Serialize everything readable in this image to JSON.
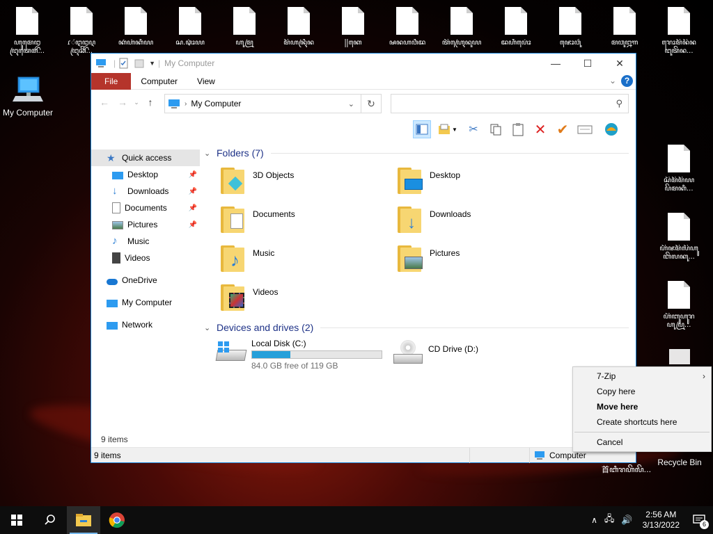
{
  "desktop": {
    "icons_top": [
      {
        "label": "ꦲꦸꦩꦺꦈ\nꦔꦿꦠꦺꦩ..."
      },
      {
        "label": "ɾꦁꦅꦈꦉ\nꦔꦿꦕꦼ..."
      },
      {
        "label": "ꦏꦁꦲꦁꦏꦶꦪ\n"
      },
      {
        "label": "ꦱ.ꦡꦴꦁꦪ\n"
      },
      {
        "label": "ꦲꦸꦩꦿꦸ\n"
      },
      {
        "label": "ꦩꦼꦲꦤꦿꦶꦤ\n"
      },
      {
        "label": "꧍꧍ꦏꦺ\n"
      },
      {
        "label": "ꦰꦤꦲꦮꦶꦢ\n"
      },
      {
        "label": "ꦠꦼꦲꦿꦺꦤꦸꦪ\n"
      },
      {
        "label": "ꦢꦲꦶꦥꦺꦴꦁ\n"
      },
      {
        "label": "ꦗꦺꦴꦮꦸꦂ\n"
      },
      {
        "label": "ꦩꦮꦸꦊꦒ\n"
      },
      {
        "label": "ꦫꦺꦴꦩꦼꦤꦼꦤ\nꦔꦸꦠꦼꦤ..."
      }
    ],
    "icons_right": [
      {
        "label": "ꦱꦼꦩꦼꦩꦼꦪ\nꦥꦼꦩꦏꦶ..."
      },
      {
        "label": "ꦲꦼꦗꦩꦼꦭꦼꦲꦸ\nꦧꦼꦭꦏꦸ..."
      },
      {
        "label": "ꦲꦼꦧꦸꦲꦸꦫ\nꦲꦸꦥꦿꦸ..."
      }
    ],
    "my_computer_label": "My Computer",
    "recycle_bin_label": "Recycle Bin",
    "bottom_right_label": "首ꦧꦶꦫꦲꦼꦭꦼ..."
  },
  "window": {
    "title": "My Computer",
    "tabs": [
      "File",
      "Computer",
      "View"
    ],
    "address": "My Computer",
    "search_placeholder": "",
    "status_items_top": "9 items",
    "status_items_bottom": "9 items",
    "status_location": "Computer"
  },
  "nav": {
    "quick_access": "Quick access",
    "pinned": [
      {
        "label": "Desktop"
      },
      {
        "label": "Downloads"
      },
      {
        "label": "Documents"
      },
      {
        "label": "Pictures"
      }
    ],
    "unpinned": [
      {
        "label": "Music"
      },
      {
        "label": "Videos"
      }
    ],
    "onedrive": "OneDrive",
    "mycomputer": "My Computer",
    "network": "Network"
  },
  "content": {
    "folders_header": "Folders (7)",
    "folders": [
      "3D Objects",
      "Desktop",
      "Documents",
      "Downloads",
      "Music",
      "Pictures",
      "Videos"
    ],
    "drives_header": "Devices and drives (2)",
    "drives": [
      {
        "name": "Local Disk (C:)",
        "free": "84.0 GB free of 119 GB",
        "used_fraction": 0.294
      },
      {
        "name": "CD Drive (D:)"
      }
    ]
  },
  "context_menu": {
    "items": [
      "7-Zip",
      "Copy here",
      "Move here",
      "Create shortcuts here"
    ],
    "cancel": "Cancel"
  },
  "taskbar": {
    "time": "2:56 AM",
    "date": "3/13/2022",
    "notifications": "6"
  }
}
